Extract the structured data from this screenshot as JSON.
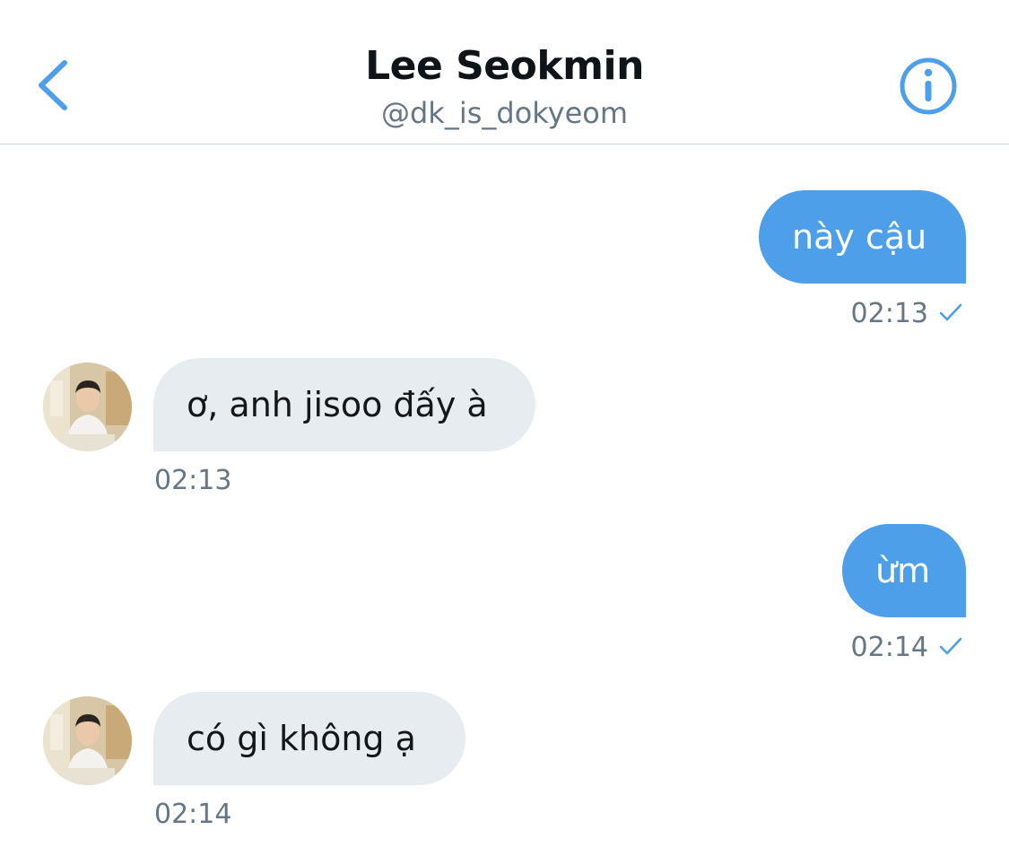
{
  "header": {
    "title": "Lee Seokmin",
    "handle": "@dk_is_dokyeom",
    "back_icon": "chevron-left-icon",
    "info_icon": "info-circle-icon",
    "accent_color": "#4c9fe8"
  },
  "conversation": {
    "messages": [
      {
        "direction": "outgoing",
        "text": "này cậu",
        "time": "02:13",
        "status_icon": "checkmark-icon"
      },
      {
        "direction": "incoming",
        "text": "ơ, anh jisoo đấy à",
        "time": "02:13",
        "avatar_icon": "user-avatar"
      },
      {
        "direction": "outgoing",
        "text": "ừm",
        "time": "02:14",
        "status_icon": "checkmark-icon"
      },
      {
        "direction": "incoming",
        "text": "có gì không ạ",
        "time": "02:14",
        "avatar_icon": "user-avatar"
      }
    ]
  },
  "colors": {
    "outgoing_bubble": "#4c9fe8",
    "incoming_bubble": "#e6ecf0",
    "secondary_text": "#657786"
  }
}
